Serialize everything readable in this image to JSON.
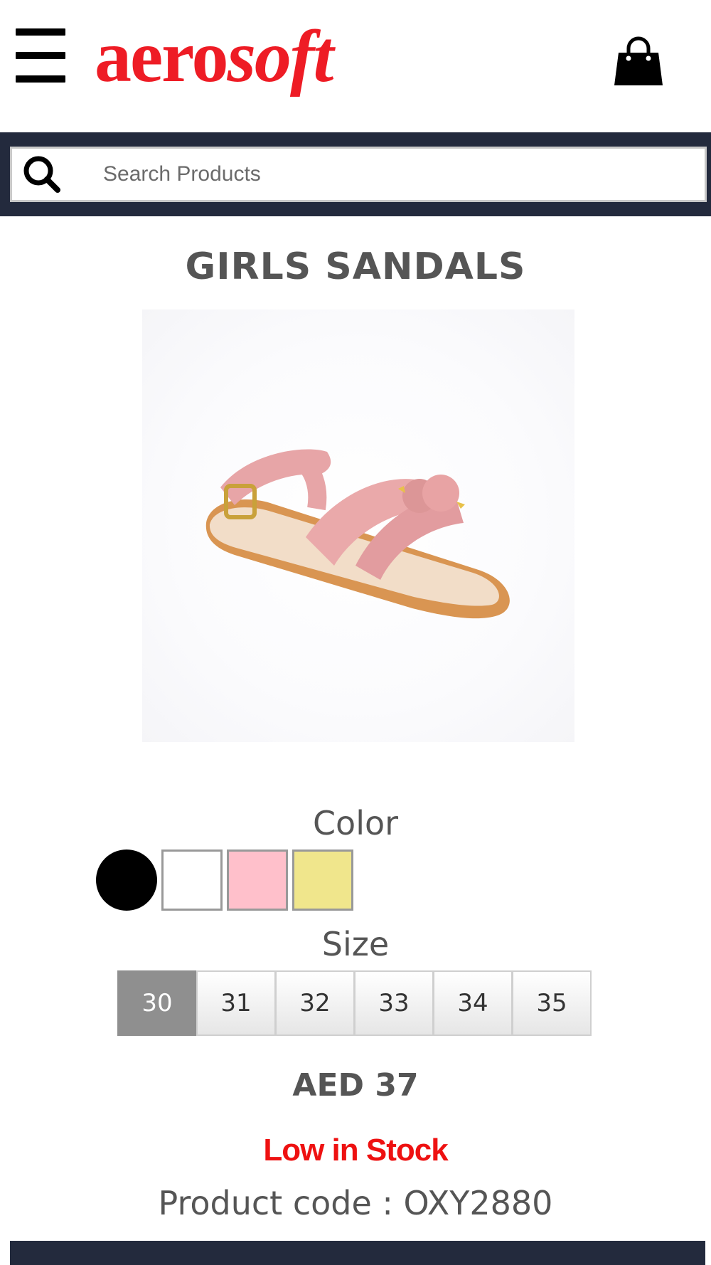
{
  "header": {
    "logo_text_main": "aero",
    "logo_text_italic": "soft",
    "brand_color": "#ee1c25",
    "menu_icon": "hamburger-menu-icon",
    "cart_icon": "shopping-bag-icon"
  },
  "search": {
    "placeholder": "Search Products",
    "icon": "search-icon",
    "bar_color": "#232a3d"
  },
  "product": {
    "title": "GIRLS SANDALS",
    "image_alt": "pink girls sandal",
    "color_label": "Color",
    "colors": [
      {
        "name": "black",
        "hex": "#000000"
      },
      {
        "name": "white",
        "hex": "#ffffff"
      },
      {
        "name": "pink",
        "hex": "#ffc0cb"
      },
      {
        "name": "khaki",
        "hex": "#f0e68c"
      }
    ],
    "size_label": "Size",
    "sizes": [
      "30",
      "31",
      "32",
      "33",
      "34",
      "35"
    ],
    "selected_size": "30",
    "price": "AED 37",
    "stock_status": "Low in Stock",
    "stock_color": "#ee1111",
    "product_code": "Product code : OXY2880"
  }
}
